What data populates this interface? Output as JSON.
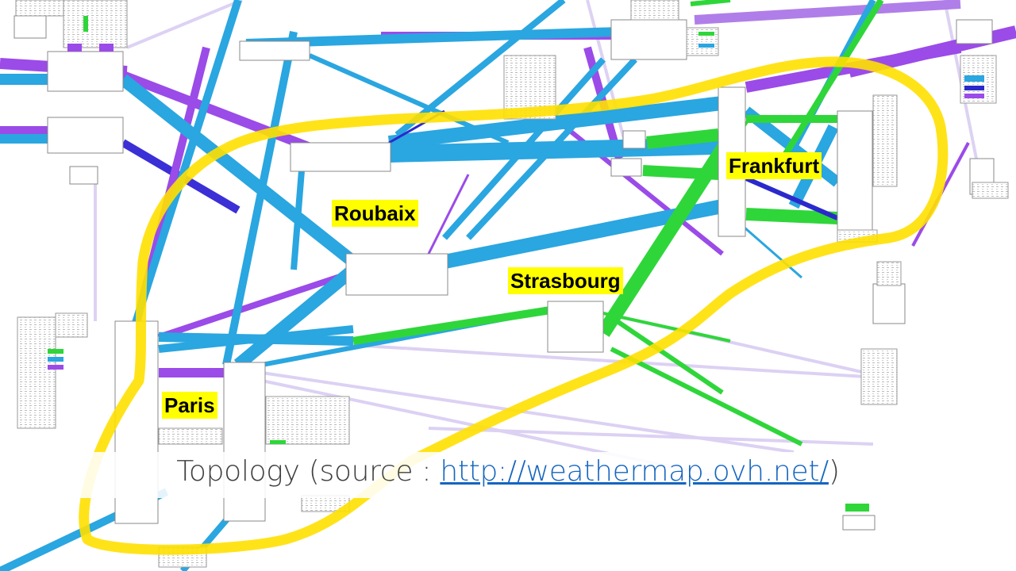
{
  "caption": {
    "prefix": "Topology (source : ",
    "link": "http://weathermap.ovh.net/",
    "suffix": ")"
  },
  "cities": {
    "roubaix": "Roubaix",
    "frankfurt": "Frankfurt",
    "strasbourg": "Strasbourg",
    "paris": "Paris"
  },
  "colors": {
    "highlight": "#ffe000",
    "label_bg": "#ffff00",
    "link_blue": "#2aa6e0",
    "link_purple": "#9b4be8",
    "link_green": "#2fd63a",
    "link_darkblue": "#2a2acc",
    "link_light": "#c9b8ec",
    "link_url": "#1565c0"
  }
}
